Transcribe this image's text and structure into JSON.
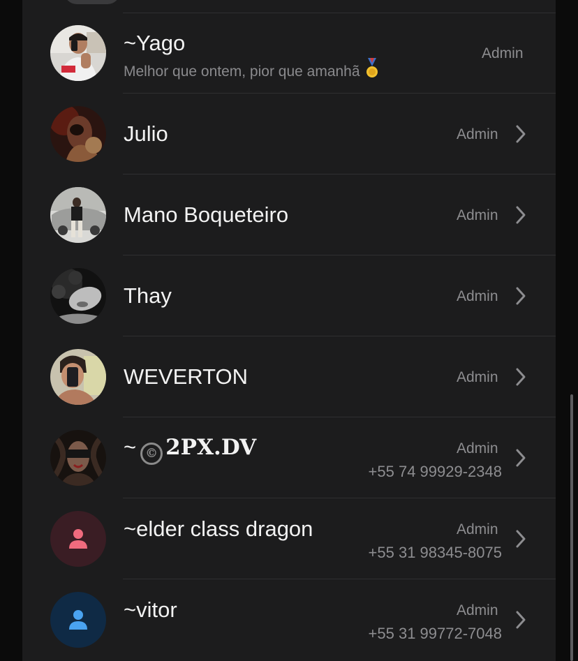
{
  "members": [
    {
      "name": "~Yago",
      "status": "Melhor que ontem, pior que amanhã",
      "status_emoji": "medal",
      "role": "Admin",
      "phone": "",
      "chevron": false,
      "avatar": "photo"
    },
    {
      "name": "Julio",
      "status": "",
      "role": "Admin",
      "phone": "",
      "chevron": true,
      "avatar": "photo"
    },
    {
      "name": "Mano Boqueteiro",
      "status": "",
      "role": "Admin",
      "phone": "",
      "chevron": true,
      "avatar": "photo"
    },
    {
      "name": "Thay",
      "status": "",
      "role": "Admin",
      "phone": "",
      "chevron": true,
      "avatar": "photo"
    },
    {
      "name": "WEVERTON",
      "status": "",
      "role": "Admin",
      "phone": "",
      "chevron": true,
      "avatar": "photo"
    },
    {
      "name_prefix": "~",
      "name_symbol": "©",
      "name": "2PX.DV",
      "status": "",
      "role": "Admin",
      "phone": "+55 74 99929-2348",
      "chevron": true,
      "avatar": "photo"
    },
    {
      "name": "~elder class dragon",
      "status": "",
      "role": "Admin",
      "phone": "+55 31 98345-8075",
      "chevron": true,
      "avatar": "person-icon",
      "avatar_bg": "#3a1d24",
      "icon_color": "#f06b7e"
    },
    {
      "name": "~vitor",
      "status": "",
      "role": "Admin",
      "phone": "+55 31 99772-7048",
      "chevron": true,
      "avatar": "person-icon",
      "avatar_bg": "#0f2a45",
      "icon_color": "#4aa3f0"
    }
  ],
  "colors": {
    "background": "#1c1c1d",
    "name_text": "#f2f2f2",
    "secondary_text": "#8d8d90",
    "separator": "#2f2f31"
  }
}
